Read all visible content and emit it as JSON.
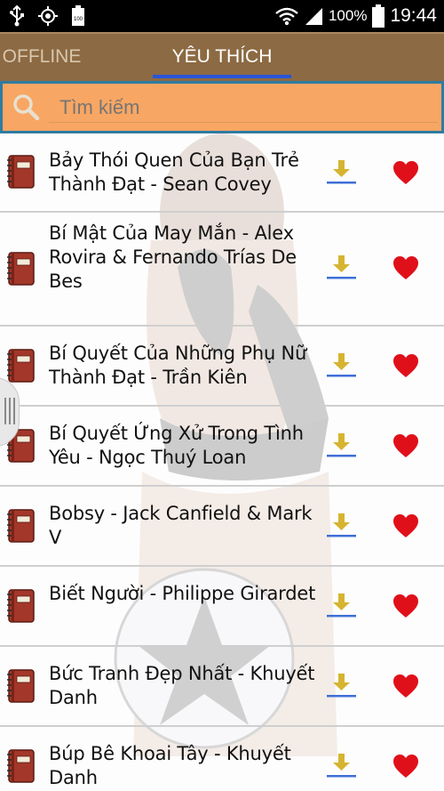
{
  "status_bar": {
    "battery_percent": "100%",
    "time": "19:44",
    "icons": [
      "usb-icon",
      "gps-icon",
      "battery-small-icon",
      "wifi-icon",
      "signal-icon",
      "battery-icon"
    ]
  },
  "tabs": [
    {
      "label": "OFFLINE",
      "selected": false
    },
    {
      "label": "YÊU THÍCH",
      "selected": true
    }
  ],
  "search": {
    "placeholder": "Tìm kiếm",
    "value": ""
  },
  "colors": {
    "tabbar": "#8c6a43",
    "tab_indicator": "#2a55d8",
    "search_bg": "#f8a663",
    "download_arrow": "#d6b431",
    "download_line": "#3f6fd6",
    "heart": "#e0101a",
    "book": "#a3372a"
  },
  "books": [
    {
      "title": "Bảy Thói Quen Của Bạn Trẻ Thành Đạt - Sean Covey"
    },
    {
      "title": "Bí Mật Của May Mắn - Alex Rovira & Fernando Trías De Bes"
    },
    {
      "title": "Bí Quyết Của Những Phụ Nữ Thành Đạt - Trần Kiên"
    },
    {
      "title": "Bí Quyết Ứng Xử Trong Tình Yêu - Ngọc Thuý Loan"
    },
    {
      "title": "Bobsy - Jack Canfield & Mark V"
    },
    {
      "title": "Biết Người - Philippe Girardet"
    },
    {
      "title": "Bức Tranh Đẹp Nhất - Khuyết Danh"
    },
    {
      "title": "Búp Bê Khoai Tây - Khuyết Danh"
    }
  ]
}
